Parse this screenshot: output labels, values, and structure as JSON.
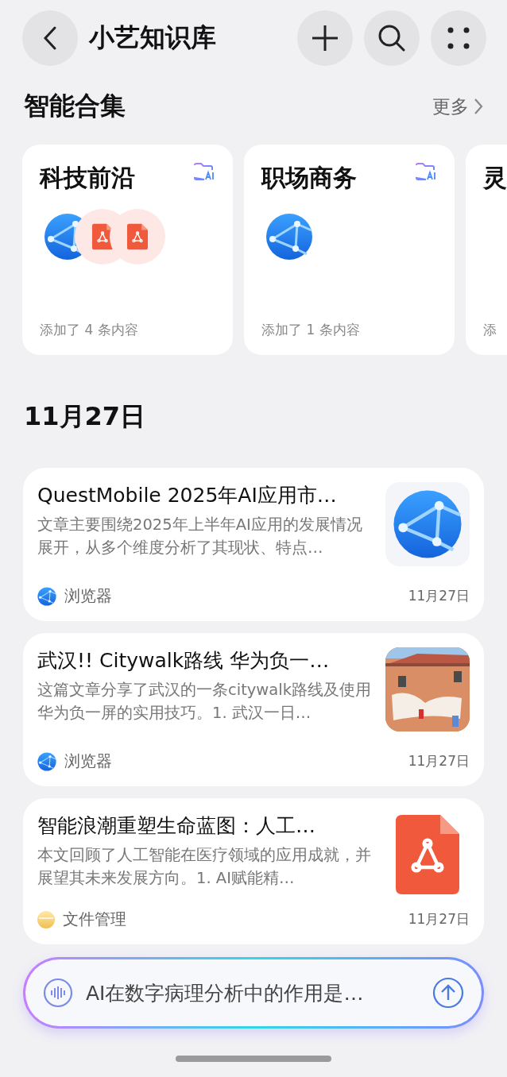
{
  "header": {
    "title": "小艺知识库"
  },
  "collections": {
    "title": "智能合集",
    "more": "更多",
    "cards": [
      {
        "title": "科技前沿",
        "items": [
          {
            "kind": "browser"
          },
          {
            "kind": "pdf"
          },
          {
            "kind": "pdf"
          }
        ],
        "footer": "添加了 4 条内容"
      },
      {
        "title": "职场商务",
        "items": [
          {
            "kind": "browser"
          }
        ],
        "footer": "添加了 1 条内容"
      },
      {
        "title": "灵",
        "footer": "添"
      }
    ]
  },
  "date_heading": "11月27日",
  "entries": [
    {
      "title": "QuestMobile 2025年AI应用市…",
      "summary": "文章主要围绕2025年上半年AI应用的发展情况展开，从多个维度分析了其现状、特点…",
      "thumb": {
        "kind": "browser"
      },
      "source": {
        "kind": "browser",
        "label": "浏览器"
      },
      "date": "11月27日"
    },
    {
      "title": "武汉!! Citywalk路线 华为负一…",
      "summary": "这篇文章分享了武汉的一条citywalk路线及使用华为负一屏的实用技巧。1. 武汉一日…",
      "source": {
        "kind": "browser",
        "label": "浏览器"
      },
      "date": "11月27日"
    },
    {
      "title": "智能浪潮重塑生命蓝图：人工…",
      "summary": "本文回顾了人工智能在医疗领域的应用成就，并展望其未来发展方向。1. AI赋能精…",
      "thumb": {
        "kind": "pdf"
      },
      "source": {
        "kind": "files",
        "label": "文件管理"
      },
      "date": "11月27日"
    }
  ],
  "ask_bar": {
    "placeholder": "AI在数字病理分析中的作用是…"
  }
}
